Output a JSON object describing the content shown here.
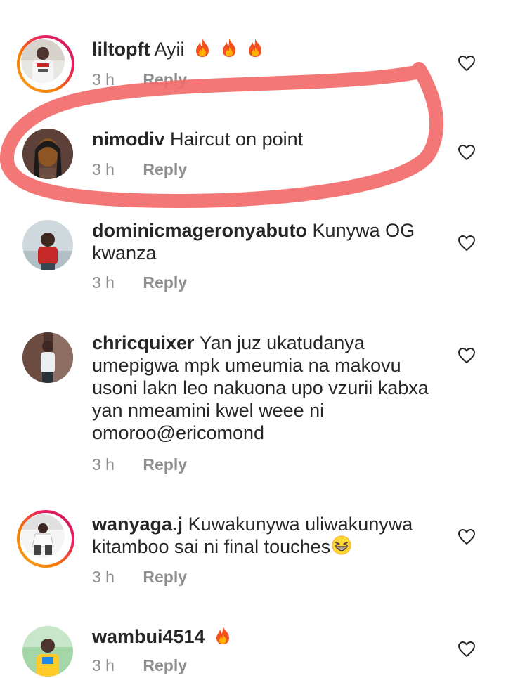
{
  "comments": [
    {
      "username": "liltopft",
      "text": "Ayii",
      "emoji": [
        "fire",
        "fire",
        "fire"
      ],
      "time": "3 h",
      "reply_label": "Reply",
      "story_ring": true
    },
    {
      "username": "nimodiv",
      "text": "Haircut on point",
      "time": "3 h",
      "reply_label": "Reply",
      "story_ring": false,
      "highlighted": true
    },
    {
      "username": "dominicmageronyabuto",
      "text": "Kunywa OG kwanza",
      "time": "3 h",
      "reply_label": "Reply",
      "story_ring": false
    },
    {
      "username": "chricquixer",
      "text": "Yan juz ukatudanya umepigwa mpk umeumia na makovu usoni lakn leo nakuona upo vzurii kabxa yan nmeamini kwel weee ni omoroo@ericomond",
      "time": "3 h",
      "reply_label": "Reply",
      "story_ring": false
    },
    {
      "username": "wanyaga.j",
      "text": "Kuwakunywa uliwakunywa kitamboo sai ni final touches",
      "emoji": [
        "grinning-squinting-face"
      ],
      "time": "3 h",
      "reply_label": "Reply",
      "story_ring": true
    },
    {
      "username": "wambui4514",
      "text": "",
      "emoji": [
        "fire"
      ],
      "time": "3 h",
      "reply_label": "Reply",
      "story_ring": false
    }
  ],
  "colors": {
    "highlight_stroke": "#f26b6b",
    "meta_gray": "#8e8e8e",
    "text": "#262626"
  }
}
